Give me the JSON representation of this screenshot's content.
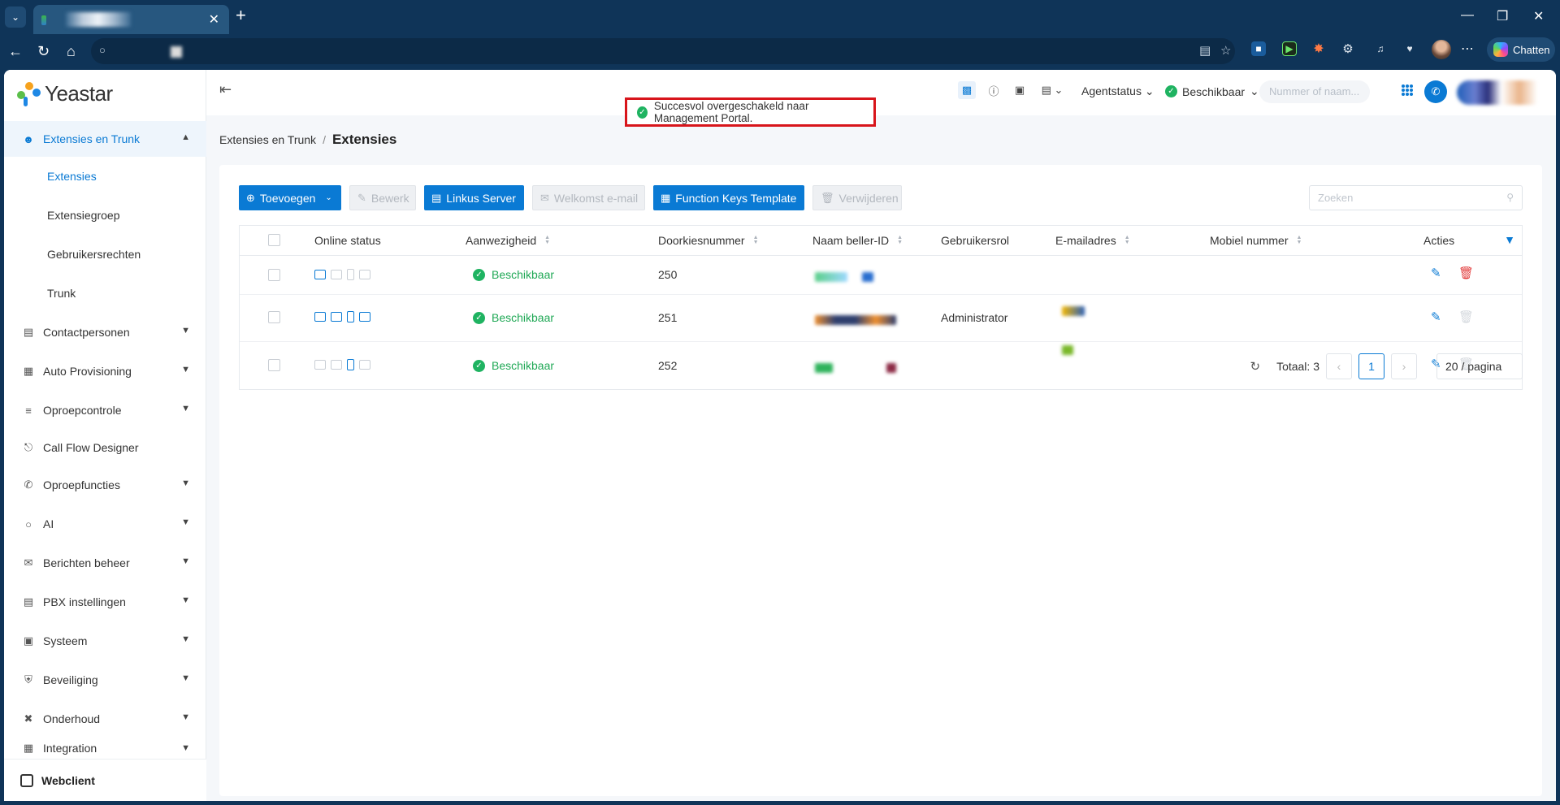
{
  "browser": {
    "new_tab_symbol": "+",
    "chat_label": "Chatten",
    "icons": [
      "tab-list-icon",
      "back-icon",
      "reload-icon",
      "home-icon",
      "lock-icon",
      "reader-icon",
      "star-icon",
      "more-icon",
      "minimize-icon",
      "maximize-icon",
      "close-icon"
    ]
  },
  "app": {
    "logo_text": "Yeastar",
    "brand_colors": {
      "accent": "#0a7ad4",
      "success": "#1fa855",
      "danger": "#e23b3b",
      "toast_border": "#d8151b"
    }
  },
  "sidebar": {
    "active_section": "Extensies en Trunk",
    "section_items": [
      {
        "label": "Extensies"
      },
      {
        "label": "Extensiegroep"
      },
      {
        "label": "Gebruikersrechten"
      },
      {
        "label": "Trunk"
      }
    ],
    "sections": [
      {
        "label": "Contactpersonen"
      },
      {
        "label": "Auto Provisioning"
      },
      {
        "label": "Oproepcontrole"
      },
      {
        "label": "Call Flow Designer"
      },
      {
        "label": "Oproepfuncties"
      },
      {
        "label": "AI"
      },
      {
        "label": "Berichten beheer"
      },
      {
        "label": "PBX instellingen"
      },
      {
        "label": "Systeem"
      },
      {
        "label": "Beveiliging"
      },
      {
        "label": "Onderhoud"
      },
      {
        "label": "Integration"
      }
    ],
    "bottom_label": "Webclient"
  },
  "header": {
    "agent_status": "Agentstatus",
    "presence": "Beschikbaar",
    "dial_placeholder": "Nummer of naam..."
  },
  "toast": {
    "message": "Succesvol overgeschakeld naar Management Portal."
  },
  "breadcrumb": {
    "parent": "Extensies en Trunk",
    "separator": "/",
    "current": "Extensies"
  },
  "toolbar": {
    "add": "Toevoegen",
    "edit": "Bewerk",
    "linkus": "Linkus Server",
    "welcome": "Welkomst e-mail",
    "fkeys": "Function Keys Template",
    "delete": "Verwijderen",
    "search_placeholder": "Zoeken"
  },
  "table": {
    "columns": {
      "online": "Online status",
      "presence": "Aanwezigheid",
      "number": "Doorkiesnummer",
      "caller_id": "Naam beller-ID",
      "role": "Gebruikersrol",
      "email": "E-mailadres",
      "mobile": "Mobiel nummer",
      "actions": "Acties"
    },
    "rows": [
      {
        "presence": "Beschikbaar",
        "number": "250",
        "role": "",
        "devices": [
          true,
          false,
          false,
          false
        ],
        "deletable": true
      },
      {
        "presence": "Beschikbaar",
        "number": "251",
        "role": "Administrator",
        "devices": [
          true,
          true,
          true,
          true
        ],
        "deletable": false
      },
      {
        "presence": "Beschikbaar",
        "number": "252",
        "role": "",
        "devices": [
          false,
          false,
          true,
          false
        ],
        "deletable": false
      }
    ]
  },
  "pagination": {
    "total": "Totaal: 3",
    "current_page": "1",
    "page_size": "20 / pagina"
  }
}
